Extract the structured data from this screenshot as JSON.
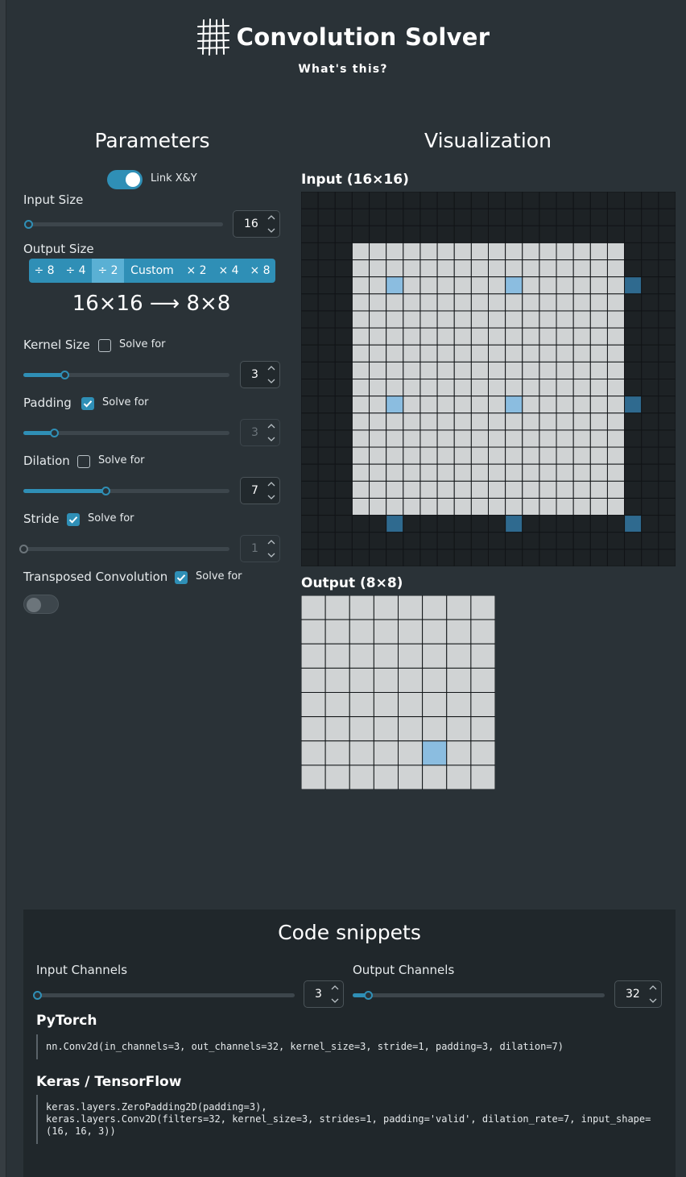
{
  "header": {
    "title": "Convolution Solver",
    "subtitle": "What's this?"
  },
  "parameters": {
    "heading": "Parameters",
    "link_xy_label": "Link X&Y",
    "link_xy_on": true,
    "input_size": {
      "label": "Input Size",
      "value": "16",
      "slider_fraction": 0.0
    },
    "output_size": {
      "label": "Output Size",
      "options": [
        "÷ 8",
        "÷ 4",
        "÷ 2",
        "Custom",
        "× 2",
        "× 4",
        "× 8"
      ],
      "selected": "÷ 2",
      "ratio_text": "16×16 ⟶ 8×8"
    },
    "kernel_size": {
      "label": "Kernel Size",
      "solve_for_label": "Solve for",
      "solve_for": false,
      "value": "3",
      "slider_fraction": 0.2
    },
    "padding": {
      "label": "Padding",
      "solve_for_label": "Solve for",
      "solve_for": true,
      "value": "3",
      "slider_fraction": 0.15
    },
    "dilation": {
      "label": "Dilation",
      "solve_for_label": "Solve for",
      "solve_for": false,
      "value": "7",
      "slider_fraction": 0.4
    },
    "stride": {
      "label": "Stride",
      "solve_for_label": "Solve for",
      "solve_for": true,
      "value": "1",
      "slider_fraction": 0.0
    },
    "transposed": {
      "label": "Transposed Convolution",
      "solve_for_label": "Solve for",
      "solve_for": true,
      "toggle_on": false
    }
  },
  "visualization": {
    "heading": "Visualization",
    "input_label": "Input (16×16)",
    "output_label": "Output (8×8)",
    "input_grid_size": 22,
    "padding": 3,
    "input_size": 16,
    "kernel_cells_inside": [
      [
        5,
        5
      ],
      [
        5,
        12
      ],
      [
        12,
        5
      ],
      [
        12,
        12
      ]
    ],
    "kernel_cells_padding": [
      [
        5,
        19
      ],
      [
        12,
        19
      ],
      [
        19,
        5
      ],
      [
        19,
        12
      ],
      [
        19,
        19
      ]
    ],
    "output_grid_size": 8,
    "output_highlight": [
      6,
      5
    ],
    "colors": {
      "padding_cell": "#1d2225",
      "input_cell": "#d0d3d4",
      "highlight_light": "#8bbde0",
      "highlight_dark": "#2f6a8f",
      "grid_line": "#111417"
    }
  },
  "code": {
    "heading": "Code snippets",
    "input_channels": {
      "label": "Input Channels",
      "value": "3",
      "slider_fraction": 0.0
    },
    "output_channels": {
      "label": "Output Channels",
      "value": "32",
      "slider_fraction": 0.06
    },
    "pytorch": {
      "label": "PyTorch",
      "code": "nn.Conv2d(in_channels=3, out_channels=32, kernel_size=3, stride=1, padding=3, dilation=7)"
    },
    "keras": {
      "label": "Keras / TensorFlow",
      "code": "keras.layers.ZeroPadding2D(padding=3),\nkeras.layers.Conv2D(filters=32, kernel_size=3, strides=1, padding='valid', dilation_rate=7, input_shape=\n(16, 16, 3))"
    }
  }
}
